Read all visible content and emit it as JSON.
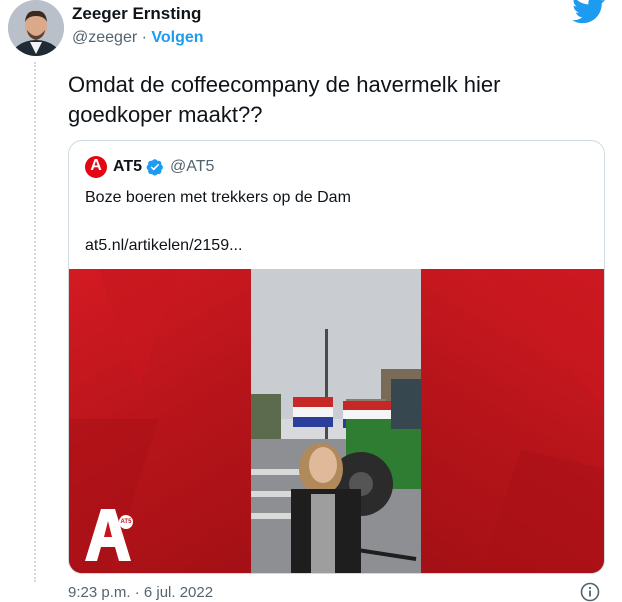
{
  "author": {
    "name": "Zeeger Ernsting",
    "handle": "@zeeger",
    "separator": "·",
    "follow_label": "Volgen"
  },
  "tweet": {
    "text": "Omdat de coffeecompany de havermelk hier goedkoper maakt??"
  },
  "quote": {
    "logo_letter": "A",
    "name": "AT5",
    "handle": "@AT5",
    "text": "Boze boeren met trekkers op de Dam",
    "link": "at5.nl/artikelen/2159...",
    "media_badge": "AT5"
  },
  "meta": {
    "timestamp": "9:23 p.m. · 6 jul. 2022"
  },
  "colors": {
    "brand_blue": "#1d9bf0",
    "at5_red": "#e30613",
    "muted": "#536471"
  },
  "icons": [
    "twitter-bird-icon",
    "verified-badge-icon",
    "info-icon"
  ]
}
